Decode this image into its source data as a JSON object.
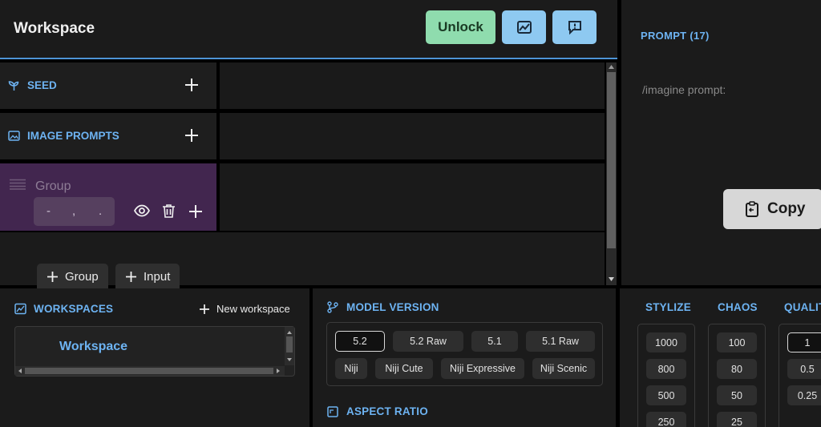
{
  "header": {
    "title": "Workspace",
    "unlock_label": "Unlock",
    "image_button_icon": "image-chart-icon",
    "feedback_button_icon": "feedback-icon"
  },
  "prompt_panel": {
    "label": "PROMPT (17)",
    "text": "/imagine prompt:",
    "copy_label": "Copy"
  },
  "rows": [
    {
      "title": "SEED",
      "icon": "seedling-icon"
    },
    {
      "title": "IMAGE PROMPTS",
      "icon": "image-icon"
    }
  ],
  "group": {
    "name_placeholder": "Group",
    "input_chars": [
      "-",
      ",",
      "."
    ]
  },
  "add_buttons": {
    "group": "Group",
    "input": "Input"
  },
  "workspaces": {
    "label": "WORKSPACES",
    "new_label": "New workspace",
    "items": [
      "Workspace"
    ]
  },
  "model_version": {
    "label": "MODEL VERSION",
    "options": [
      "5.2",
      "5.2 Raw",
      "5.1",
      "5.1 Raw",
      "Niji",
      "Niji Cute",
      "Niji Expressive",
      "Niji Scenic"
    ],
    "selected": "5.2"
  },
  "aspect_ratio": {
    "label": "ASPECT RATIO"
  },
  "stylize": {
    "label": "STYLIZE",
    "values": [
      "1000",
      "800",
      "500",
      "250"
    ]
  },
  "chaos": {
    "label": "CHAOS",
    "values": [
      "100",
      "80",
      "50",
      "25"
    ]
  },
  "quality": {
    "label": "QUALIT",
    "values": [
      "1",
      "0.5",
      "0.25"
    ],
    "selected": "1"
  },
  "colors": {
    "accent_blue": "#6db3f2",
    "unlock_green": "#8fdcae",
    "button_blue": "#8ec9f1",
    "group_purple": "#42264f"
  }
}
